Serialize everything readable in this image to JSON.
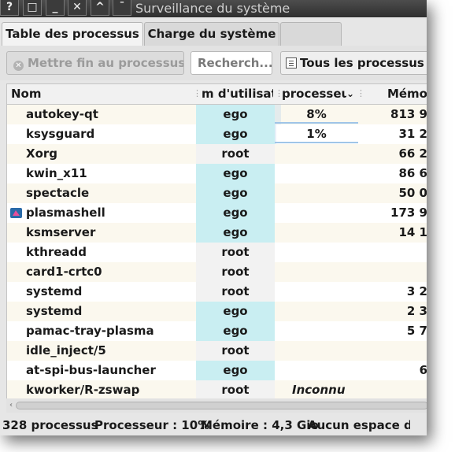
{
  "window": {
    "title": "Surveillance du système",
    "titlebar_buttons": [
      "?",
      "□",
      "_",
      "✕",
      "^",
      "¯"
    ]
  },
  "tabs": [
    {
      "label": "Table des processus",
      "active": true
    },
    {
      "label": "Charge du système",
      "active": false
    }
  ],
  "toolbar": {
    "end_process_label": "Mettre fin au processus...",
    "search_value": "Recherch...",
    "filter_label": "Tous les processus"
  },
  "table": {
    "columns": [
      "Nom",
      "m d'utilisate",
      "processeu",
      "Mémo"
    ],
    "sorted_column": "processeu",
    "rows": [
      {
        "name": "autokey-qt",
        "user": "ego",
        "cpu": "8%",
        "mem": "813 9",
        "cpu_bar": 0.08
      },
      {
        "name": "ksysguard",
        "user": "ego",
        "cpu": "1%",
        "mem": "31 2",
        "cpu_bar": 0.01
      },
      {
        "name": "Xorg",
        "user": "root",
        "cpu": "",
        "mem": "66 2"
      },
      {
        "name": "kwin_x11",
        "user": "ego",
        "cpu": "",
        "mem": "86 6"
      },
      {
        "name": "spectacle",
        "user": "ego",
        "cpu": "",
        "mem": "50 0"
      },
      {
        "name": "plasmashell",
        "user": "ego",
        "cpu": "",
        "mem": "173 9",
        "icon": "plasma-icon"
      },
      {
        "name": "ksmserver",
        "user": "ego",
        "cpu": "",
        "mem": "14 1"
      },
      {
        "name": "kthreadd",
        "user": "root",
        "cpu": "",
        "mem": ""
      },
      {
        "name": "card1-crtc0",
        "user": "root",
        "cpu": "",
        "mem": ""
      },
      {
        "name": "systemd",
        "user": "root",
        "cpu": "",
        "mem": "3 2"
      },
      {
        "name": "systemd",
        "user": "ego",
        "cpu": "",
        "mem": "2 3"
      },
      {
        "name": "pamac-tray-plasma",
        "user": "ego",
        "cpu": "",
        "mem": "5 7"
      },
      {
        "name": "idle_inject/5",
        "user": "root",
        "cpu": "",
        "mem": ""
      },
      {
        "name": "at-spi-bus-launcher",
        "user": "ego",
        "cpu": "",
        "mem": "6"
      },
      {
        "name": "kworker/R-zswap",
        "user": "root",
        "cpu": "Inconnu",
        "mem": ""
      }
    ]
  },
  "statusbar": {
    "process_count": "328 processus",
    "cpu": "Processeur : 10%",
    "memory": "Mémoire : 4,3 Gio",
    "swap": "Aucun espace d'é"
  },
  "colors": {
    "user_ego_bg": "#c9eef2",
    "user_root_bg": "#f2f2f2",
    "row_alt_bg": "#fbf8ee",
    "cpu_bar": "#9fc5e8"
  }
}
